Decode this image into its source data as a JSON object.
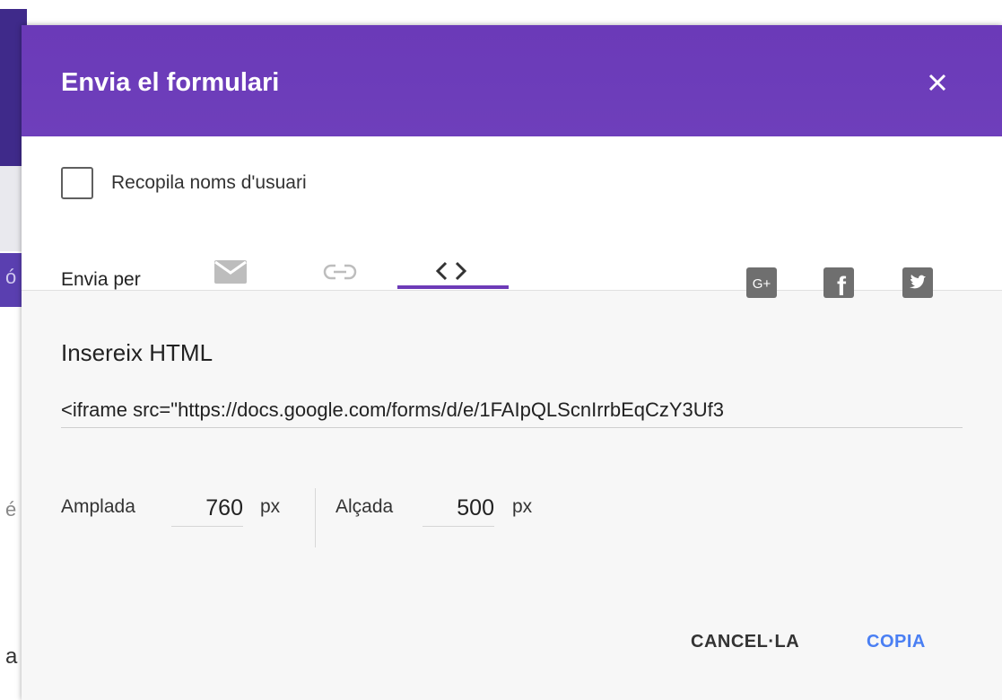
{
  "background": {
    "chars": [
      "ó",
      "é",
      "a"
    ]
  },
  "dialog": {
    "title": "Envia el formulari",
    "collect_usernames_label": "Recopila noms d'usuari",
    "send_via_label": "Envia per",
    "tabs": [
      {
        "icon": "email-icon"
      },
      {
        "icon": "link-icon"
      },
      {
        "icon": "code-icon"
      }
    ],
    "social": [
      {
        "icon": "google-plus-icon",
        "text": "G+"
      },
      {
        "icon": "facebook-icon",
        "text": "f"
      },
      {
        "icon": "twitter-icon"
      }
    ],
    "embed_title": "Insereix HTML",
    "embed_code": "<iframe src=\"https://docs.google.com/forms/d/e/1FAIpQLScnIrrbEqCzY3Uf3",
    "width_label": "Amplada",
    "width_value": "760",
    "height_label": "Alçada",
    "height_value": "500",
    "unit": "px",
    "cancel_label": "CANCEL·LA",
    "copy_label": "COPIA"
  },
  "colors": {
    "header": "#6d3ab7",
    "accent_blue": "#4a7ff3",
    "icon_gray": "#aaaaaa"
  }
}
